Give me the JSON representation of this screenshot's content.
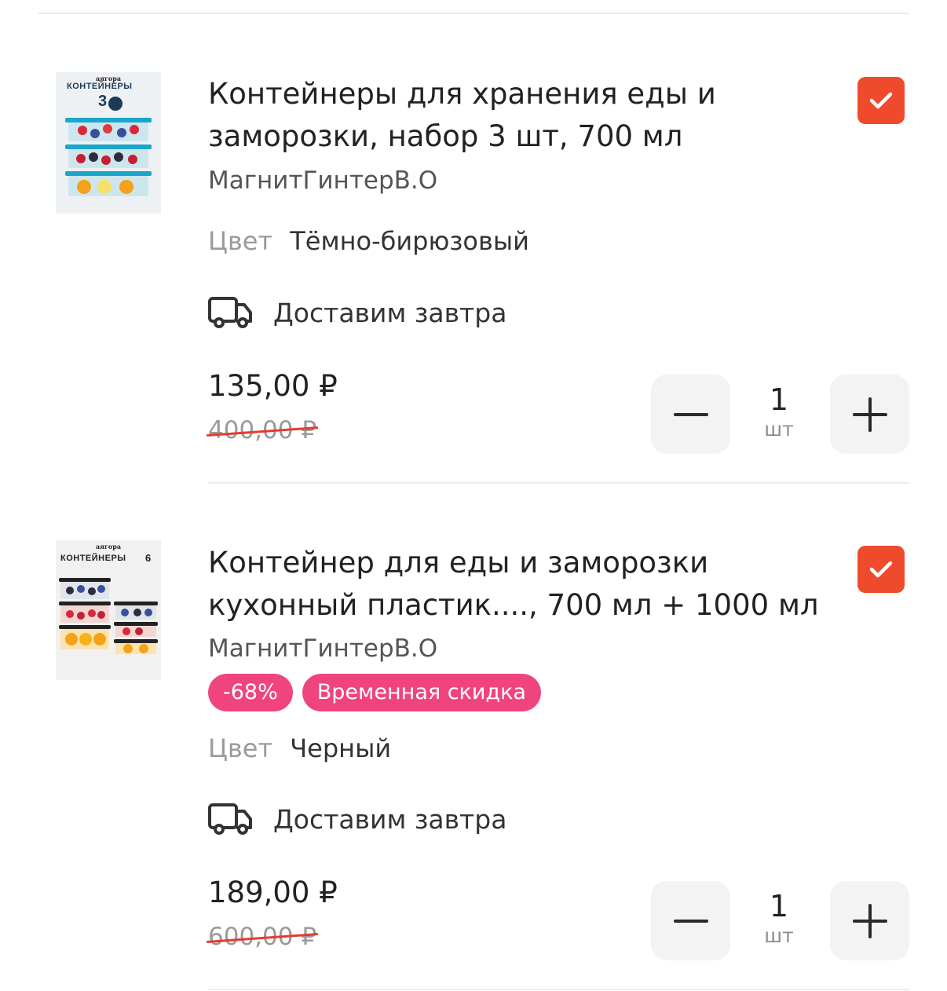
{
  "colors": {
    "accent": "#f04a2c",
    "badge": "#f0447f",
    "strike": "#e63b2e"
  },
  "products": [
    {
      "thumb_brand": "аягора",
      "thumb_title": "КОНТЕЙНЕРЫ",
      "thumb_count": "3",
      "title": "Контейнеры для хранения еды и заморозки, набор 3 шт, 700 мл",
      "seller": "МагнитГинтерВ.О",
      "color_label": "Цвет",
      "color_value": "Тёмно-бирюзовый",
      "delivery": "Доставим завтра",
      "price": "135,00 ₽",
      "old_price": "400,00 ₽",
      "qty": "1",
      "unit": "шт",
      "checked": true,
      "badges": []
    },
    {
      "thumb_brand": "аягора",
      "thumb_title": "КОНТЕЙНЕРЫ",
      "thumb_count": "6",
      "title": "Контейнер для еды и заморозки кухонный пластик...., 700 мл + 1000 мл",
      "seller": "МагнитГинтерВ.О",
      "badges": [
        "-68%",
        "Временная скидка"
      ],
      "color_label": "Цвет",
      "color_value": "Черный",
      "delivery": "Доставим завтра",
      "price": "189,00 ₽",
      "old_price": "600,00 ₽",
      "qty": "1",
      "unit": "шт",
      "checked": true
    }
  ]
}
